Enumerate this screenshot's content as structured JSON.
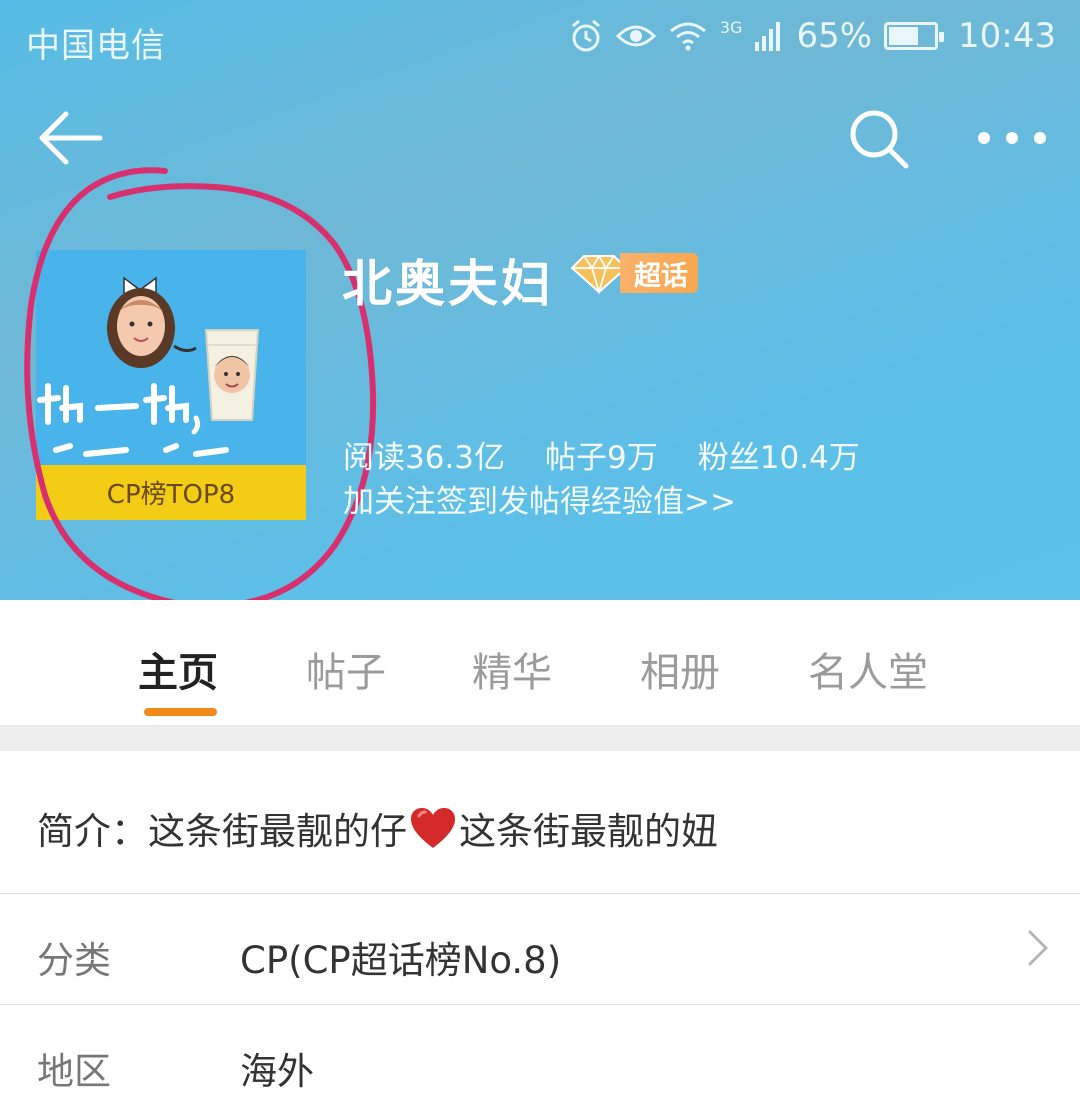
{
  "status_bar": {
    "carrier": "中国电信",
    "network": "3G",
    "battery": "65%",
    "battery_level": 0.65,
    "time": "10:43",
    "icons": [
      "alarm-icon",
      "eye-icon",
      "wifi-icon",
      "signal-icon",
      "battery-icon"
    ]
  },
  "nav": {
    "back_icon": "back-arrow-icon",
    "search_icon": "search-icon",
    "more_icon": "more-dots-icon"
  },
  "topic": {
    "title": "北奥夫妇",
    "badge": "超话",
    "avatar_rank": "CP榜TOP8",
    "stats": {
      "reads": "阅读36.3亿",
      "posts": "帖子9万",
      "fans": "粉丝10.4万"
    },
    "follow_hint": "加关注签到发帖得经验值>>"
  },
  "tabs": [
    {
      "label": "主页",
      "active": true
    },
    {
      "label": "帖子",
      "active": false
    },
    {
      "label": "精华",
      "active": false
    },
    {
      "label": "相册",
      "active": false
    },
    {
      "label": "名人堂",
      "active": false
    }
  ],
  "intro": {
    "label": "简介：",
    "text_before": "这条街最靓的仔",
    "text_after": "这条街最靓的妞"
  },
  "info_rows": {
    "category_label": "分类",
    "category_value": "CP(CP超话榜No.8)",
    "region_label": "地区",
    "region_value": "海外"
  },
  "colors": {
    "header_bg": "#5cc0e8",
    "tab_accent": "#f28a18",
    "rank_bg": "#f2cc15",
    "annotation": "#d8306f"
  }
}
